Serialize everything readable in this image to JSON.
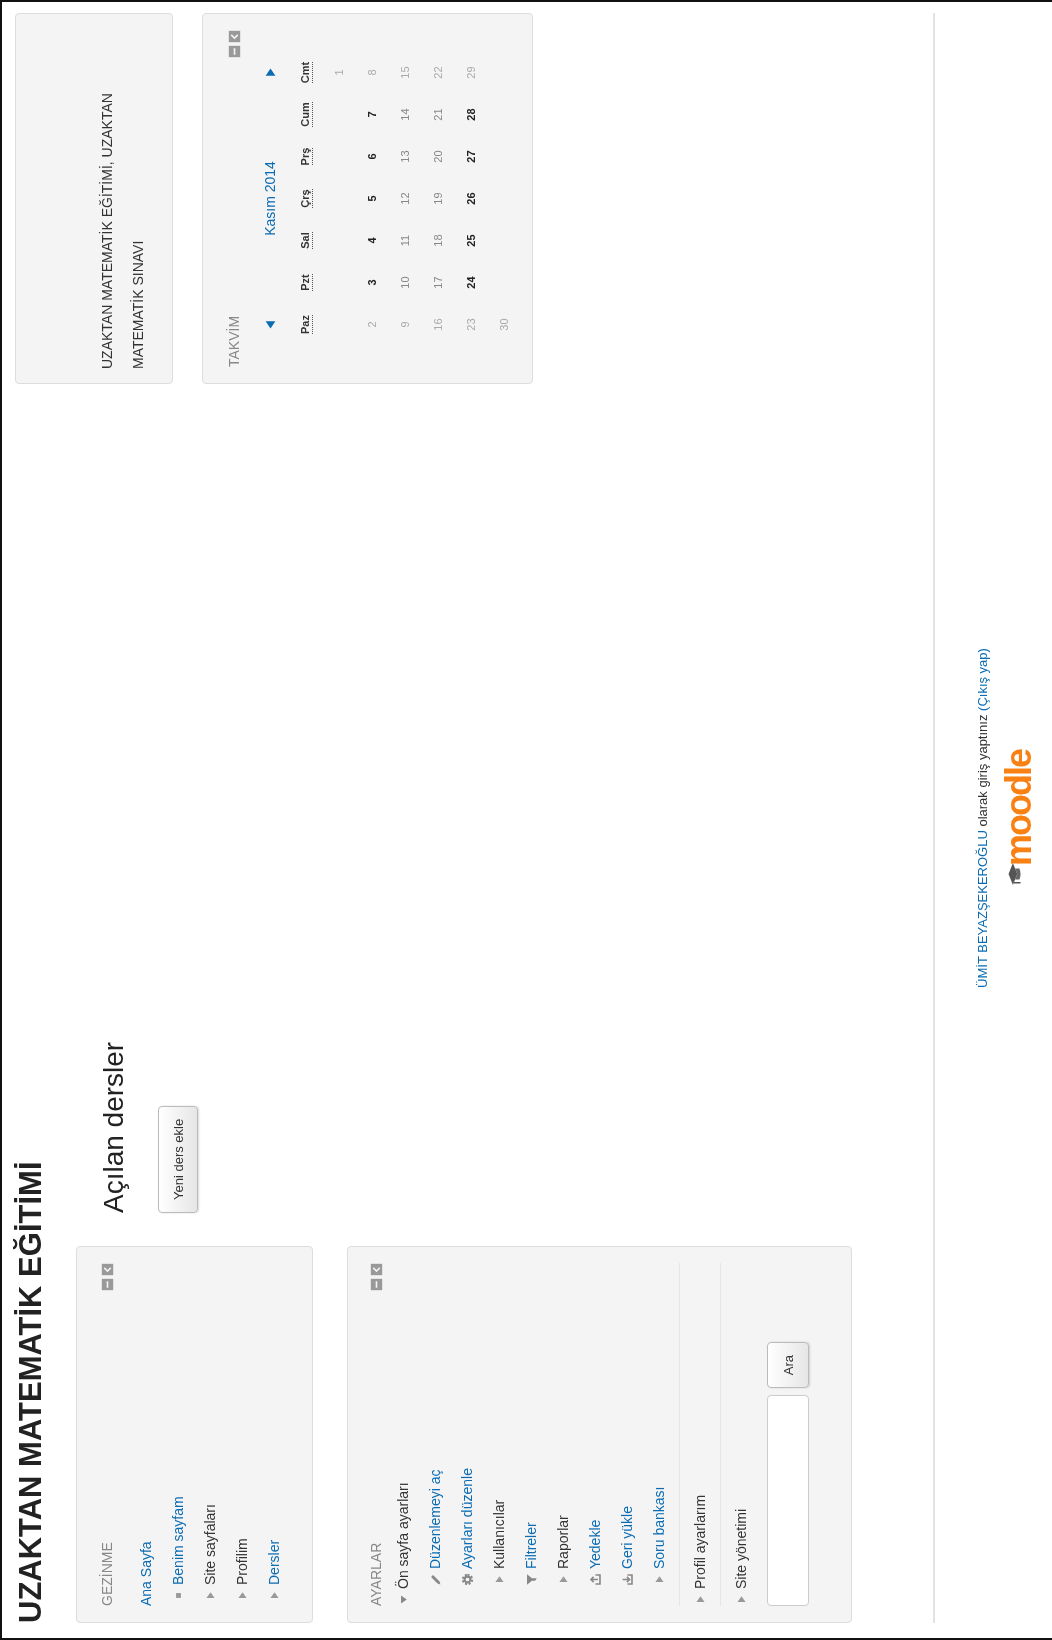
{
  "site_title": "UZAKTAN MATEMATİK EĞİTİMİ",
  "navigation_block": {
    "title": "GEZİNME",
    "items": [
      {
        "label": "Ana Sayfa",
        "kind": "home",
        "link": true,
        "children": [
          {
            "label": "Benim sayfam",
            "kind": "leaf",
            "link": true
          },
          {
            "label": "Site sayfaları",
            "kind": "branch",
            "expanded": false,
            "link": false
          },
          {
            "label": "Profilim",
            "kind": "branch",
            "expanded": false,
            "link": false
          },
          {
            "label": "Dersler",
            "kind": "branch",
            "expanded": false,
            "link": true
          }
        ]
      }
    ]
  },
  "settings_block": {
    "title": "AYARLAR",
    "sections": [
      {
        "items": [
          {
            "label": "Ön sayfa ayarları",
            "kind": "branch",
            "expanded": true,
            "link": false,
            "children": [
              {
                "label": "Düzenlemeyi aç",
                "kind": "pencil",
                "link": true
              },
              {
                "label": "Ayarları düzenle",
                "kind": "gear",
                "link": true
              },
              {
                "label": "Kullanıcılar",
                "kind": "branch",
                "expanded": false,
                "link": false
              },
              {
                "label": "Filtreler",
                "kind": "filter",
                "link": true
              },
              {
                "label": "Raporlar",
                "kind": "branch",
                "expanded": false,
                "link": false
              },
              {
                "label": "Yedekle",
                "kind": "upload",
                "link": true
              },
              {
                "label": "Geri yükle",
                "kind": "download",
                "link": true
              },
              {
                "label": "Soru bankası",
                "kind": "branch",
                "expanded": false,
                "link": true
              }
            ]
          }
        ]
      },
      {
        "items": [
          {
            "label": "Profil ayarlarım",
            "kind": "branch",
            "expanded": false,
            "link": false
          }
        ]
      },
      {
        "items": [
          {
            "label": "Site yönetimi",
            "kind": "branch",
            "expanded": false,
            "link": false
          }
        ]
      }
    ],
    "search_button": "Ara"
  },
  "main": {
    "heading": "Açılan dersler",
    "button": "Yeni ders ekle"
  },
  "course_block": {
    "text": "UZAKTAN MATEMATİK EĞİTİMİ, UZAKTAN MATEMATİK SINAVI"
  },
  "calendar": {
    "title": "TAKVİM",
    "month": "Kasım 2014",
    "weekdays": [
      {
        "label": "Paz",
        "weekend": true
      },
      {
        "label": "Pzt",
        "weekend": false
      },
      {
        "label": "Sal",
        "weekend": false
      },
      {
        "label": "Çrş",
        "weekend": false
      },
      {
        "label": "Prş",
        "weekend": false
      },
      {
        "label": "Cum",
        "weekend": false
      },
      {
        "label": "Cmt",
        "weekend": true
      }
    ],
    "weeks": [
      {
        "kind": "first",
        "days": [
          {
            "day": "1",
            "event": false
          }
        ]
      },
      {
        "kind": "full",
        "days": [
          {
            "day": "2",
            "event": false
          },
          {
            "day": "3",
            "event": true
          },
          {
            "day": "4",
            "event": true
          },
          {
            "day": "5",
            "event": true
          },
          {
            "day": "6",
            "event": true
          },
          {
            "day": "7",
            "event": true
          },
          {
            "day": "8",
            "event": false
          }
        ]
      },
      {
        "kind": "full",
        "days": [
          {
            "day": "9",
            "event": false
          },
          {
            "day": "10",
            "event": false
          },
          {
            "day": "11",
            "event": false
          },
          {
            "day": "12",
            "event": false
          },
          {
            "day": "13",
            "event": false
          },
          {
            "day": "14",
            "event": false
          },
          {
            "day": "15",
            "event": false
          }
        ]
      },
      {
        "kind": "full",
        "days": [
          {
            "day": "16",
            "event": false
          },
          {
            "day": "17",
            "event": false
          },
          {
            "day": "18",
            "event": false
          },
          {
            "day": "19",
            "event": false
          },
          {
            "day": "20",
            "event": false
          },
          {
            "day": "21",
            "event": false
          },
          {
            "day": "22",
            "event": false
          }
        ]
      },
      {
        "kind": "full",
        "days": [
          {
            "day": "23",
            "event": false
          },
          {
            "day": "24",
            "event": true
          },
          {
            "day": "25",
            "event": true
          },
          {
            "day": "26",
            "event": true
          },
          {
            "day": "27",
            "event": true
          },
          {
            "day": "28",
            "event": true
          },
          {
            "day": "29",
            "event": false
          }
        ]
      },
      {
        "kind": "last",
        "days": [
          {
            "day": "30",
            "event": false
          }
        ]
      }
    ]
  },
  "footer": {
    "user": "ÜMİT BEYAZŞEKEROĞLU",
    "message": "olarak giriş yaptınız",
    "logout": "(Çıkış yap)",
    "logo": "moodle"
  }
}
